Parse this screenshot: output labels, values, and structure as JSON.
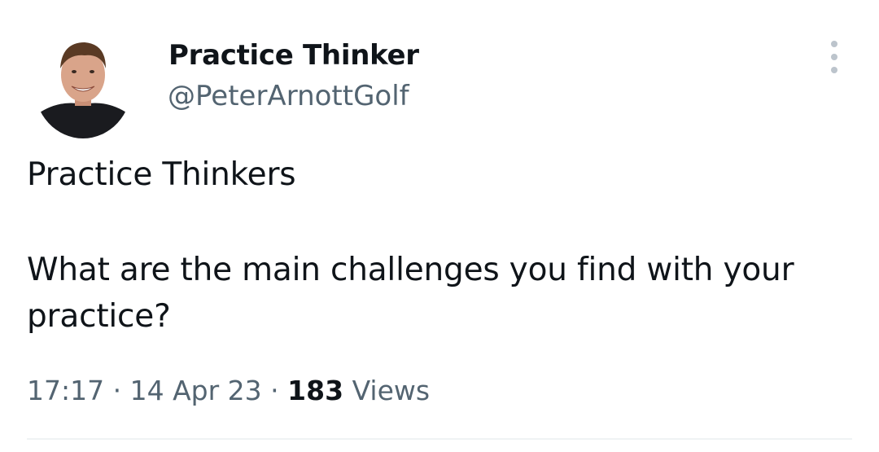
{
  "author": {
    "display_name": "Practice Thinker",
    "handle": "@PeterArnottGolf"
  },
  "tweet": {
    "line1": "Practice Thinkers",
    "line2": "What are the main challenges you find with your practice?"
  },
  "meta": {
    "time": "17:17",
    "separator": "·",
    "date": "14 Apr 23",
    "views_count": "183",
    "views_label": "Views"
  },
  "icons": {
    "more": "more-vertical-icon"
  },
  "colors": {
    "text": "#0f1419",
    "secondary": "#536471",
    "divider": "#eff3f4"
  }
}
